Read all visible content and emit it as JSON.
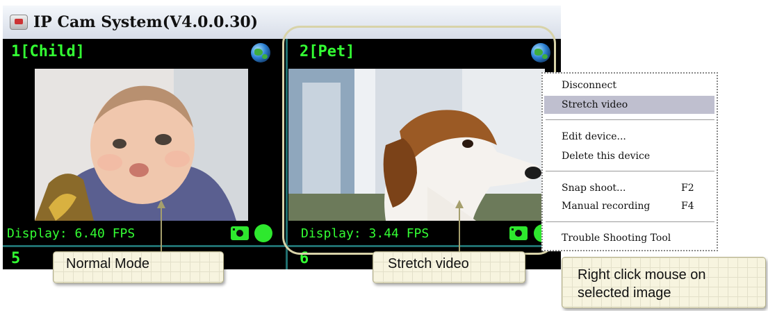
{
  "window": {
    "title": "IP Cam System(V4.0.0.30)"
  },
  "cells": [
    {
      "label": "1[Child]",
      "fps": "Display: 6.40 FPS"
    },
    {
      "label": "2[Pet]",
      "fps": "Display: 3.44 FPS"
    },
    {
      "label": "5"
    },
    {
      "label": "6"
    }
  ],
  "context_menu": {
    "items": [
      {
        "label": "Disconnect"
      },
      {
        "label": "Stretch video",
        "selected": true
      },
      {
        "label": "Edit device..."
      },
      {
        "label": "Delete this device"
      },
      {
        "label": "Snap shoot...",
        "shortcut": "F2"
      },
      {
        "label": "Manual recording",
        "shortcut": "F4"
      },
      {
        "label": "Trouble Shooting Tool"
      }
    ]
  },
  "callouts": {
    "normal_mode": "Normal Mode",
    "stretch_video": "Stretch video",
    "right_click": "Right click mouse on selected image"
  },
  "icons": [
    "app-icon",
    "globe-icon",
    "camera-icon",
    "record-icon"
  ],
  "colors": {
    "overlay_text": "#33ff33",
    "grid_line": "#1f6f6f",
    "highlight": "#d8d3a8",
    "menu_selected": "#bfbfcf",
    "callout_bg": "#f7f4df"
  }
}
